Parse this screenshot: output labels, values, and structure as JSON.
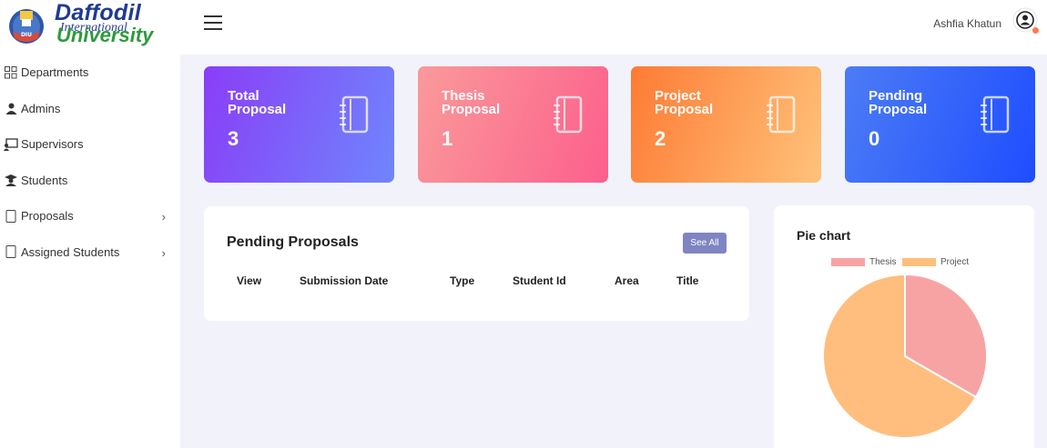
{
  "brand": {
    "line1": "Daffodil",
    "line2": "International",
    "line3": "University"
  },
  "sidebar": {
    "items": [
      {
        "label": "Departments",
        "icon": "grid-icon"
      },
      {
        "label": "Admins",
        "icon": "user-icon"
      },
      {
        "label": "Supervisors",
        "icon": "presentation-icon"
      },
      {
        "label": "Students",
        "icon": "graduation-cap-icon"
      },
      {
        "label": "Proposals",
        "icon": "notebook-icon",
        "has_children": true
      },
      {
        "label": "Assigned Students",
        "icon": "notebook-icon",
        "has_children": true
      }
    ]
  },
  "header": {
    "user_name": "Ashfia Khatun"
  },
  "cards": [
    {
      "title_line1": "Total",
      "title_line2": "Proposal",
      "value": "3"
    },
    {
      "title_line1": "Thesis",
      "title_line2": "Proposal",
      "value": "1"
    },
    {
      "title_line1": "Project",
      "title_line2": "Proposal",
      "value": "2"
    },
    {
      "title_line1": "Pending",
      "title_line2": "Proposal",
      "value": "0"
    }
  ],
  "pending": {
    "title": "Pending Proposals",
    "see_all": "See All",
    "columns": [
      "View",
      "Submission Date",
      "Type",
      "Student Id",
      "Area",
      "Title"
    ]
  },
  "chart_data": {
    "type": "pie",
    "title": "Pie chart",
    "labels": [
      "Thesis",
      "Project"
    ],
    "values": [
      1,
      2
    ],
    "colors": [
      "#f8a3a3",
      "#ffbe7d"
    ],
    "legend": "top"
  },
  "colors": {
    "accent": "#7f85c2",
    "status_dot": "#fe7c4e"
  }
}
